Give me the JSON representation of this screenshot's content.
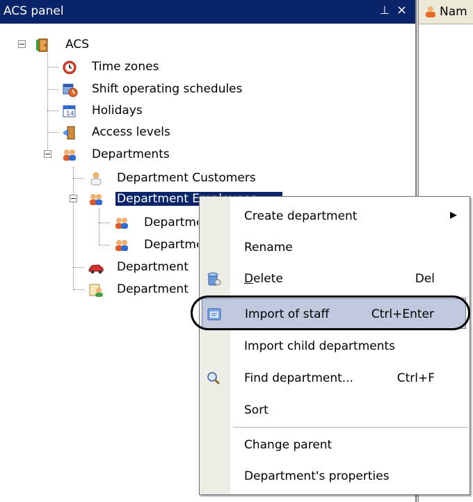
{
  "panel": {
    "title": "ACS panel",
    "pin_glyph": "⊥",
    "close_glyph": "×"
  },
  "right_pane": {
    "header_text": "Nam"
  },
  "tree": {
    "root": "ACS",
    "items": {
      "time_zones": "Time zones",
      "shift_schedules": "Shift operating schedules",
      "holidays": "Holidays",
      "access_levels": "Access levels",
      "departments": "Departments",
      "dept_customers": "Department Customers",
      "dept_employees": "Department Employees",
      "child1": "Department",
      "child2": "Department",
      "dept_4": "Department",
      "dept_5": "Department"
    }
  },
  "context_menu": {
    "create_department": "Create department",
    "rename": "Rename",
    "delete_pre": "",
    "delete_u": "D",
    "delete_post": "elete",
    "delete_shortcut": "Del",
    "import_staff": "Import of staff",
    "import_staff_shortcut": "Ctrl+Enter",
    "import_child": "Import child departments",
    "find_department": "Find department...",
    "find_shortcut": "Ctrl+F",
    "sort": "Sort",
    "change_parent": "Change parent",
    "properties": "Department's properties"
  }
}
